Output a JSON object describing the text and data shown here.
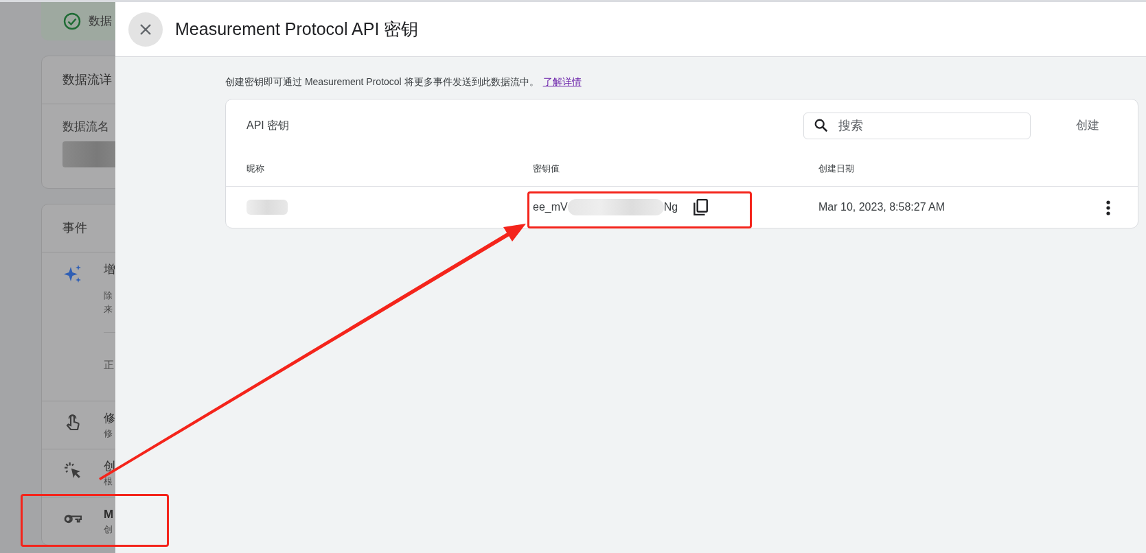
{
  "background_page": {
    "banner": {
      "text": "数据"
    },
    "stream_card": {
      "title": "数据流详",
      "field_label": "数据流名"
    },
    "events_card": {
      "title": "事件",
      "items": [
        {
          "kind": "sparkle",
          "title": "增",
          "lines": [
            "除",
            "来"
          ],
          "footer": "正"
        },
        {
          "kind": "touch",
          "title": "修",
          "subtitle": "修"
        },
        {
          "kind": "cursor",
          "title": "创",
          "subtitle": "根"
        },
        {
          "kind": "key",
          "title": "M",
          "subtitle": "创"
        }
      ]
    }
  },
  "drawer": {
    "title": "Measurement Protocol API 密钥",
    "description": "创建密钥即可通过 Measurement Protocol 将更多事件发送到此数据流中。",
    "learn_more_link": "了解详情",
    "table_card": {
      "title": "API 密钥",
      "search": {
        "placeholder": "搜索"
      },
      "create_button": "创建",
      "columns": [
        "昵称",
        "密钥值",
        "创建日期"
      ],
      "rows": [
        {
          "key_value_start": "ee_mV",
          "key_value_end": "Ng",
          "created": "Mar 10, 2023, 8:58:27 AM"
        }
      ]
    }
  }
}
